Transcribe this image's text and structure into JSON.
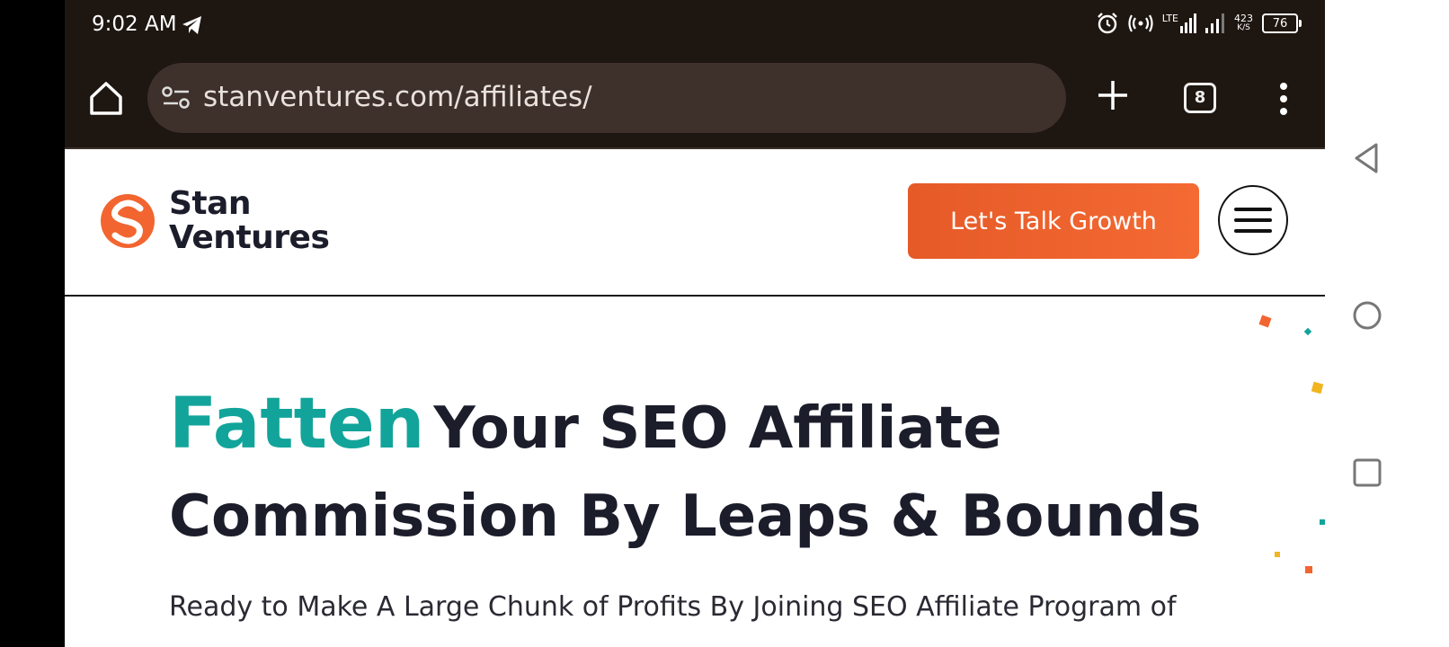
{
  "status_bar": {
    "time": "9:02 AM",
    "network_type": "LTE",
    "net_speed_value": "423",
    "net_speed_unit": "K/S",
    "battery": "76"
  },
  "browser": {
    "url": "stanventures.com/affiliates/",
    "tab_count": "8"
  },
  "site": {
    "logo_line1": "Stan",
    "logo_line2": "Ventures",
    "cta_label": "Let's Talk Growth",
    "brand_orange": "#f26530",
    "accent_teal": "#12a49a"
  },
  "hero": {
    "headline_accent": "Fatten",
    "headline_rest": "Your SEO Affiliate",
    "headline_line2": "Commission By Leaps & Bounds",
    "subtext": "Ready to Make A Large Chunk of Profits By Joining SEO Affiliate Program of"
  },
  "icons": {
    "home": "home-icon",
    "site_info": "tune-icon",
    "new_tab": "plus-icon",
    "menu": "more-vert-icon",
    "nav_back": "triangle-back-icon",
    "nav_home": "circle-home-icon",
    "nav_recents": "square-recents-icon"
  }
}
